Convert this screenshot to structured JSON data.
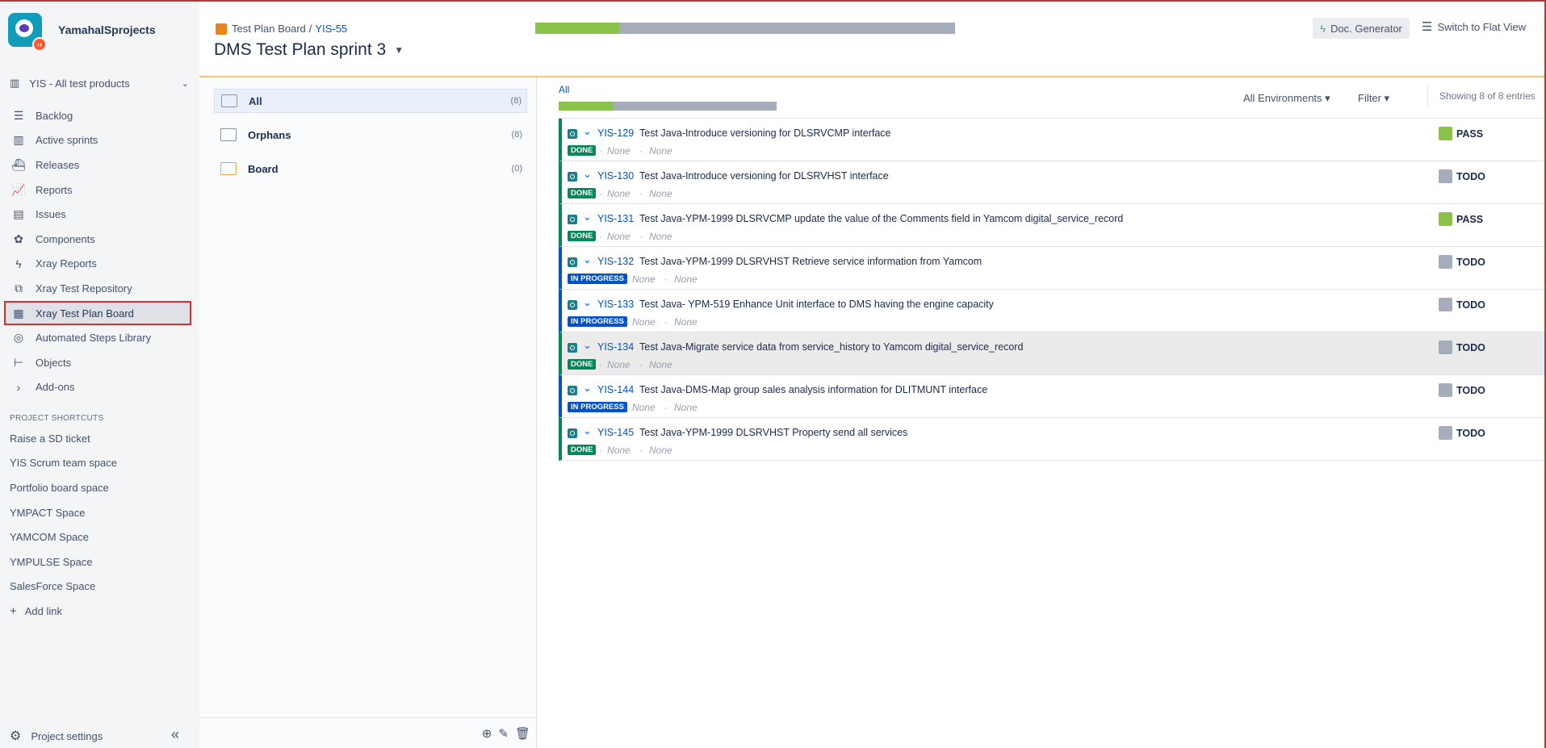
{
  "sidebar": {
    "project_name": "YamahalSprojects",
    "project_select": "YIS - All test products",
    "nav": [
      {
        "label": "Backlog",
        "icon": "backlog-icon",
        "glyph": "☰"
      },
      {
        "label": "Active sprints",
        "icon": "board-icon",
        "glyph": "▥"
      },
      {
        "label": "Releases",
        "icon": "ship-icon",
        "glyph": "⛴"
      },
      {
        "label": "Reports",
        "icon": "chart-icon",
        "glyph": "📈"
      },
      {
        "label": "Issues",
        "icon": "issues-icon",
        "glyph": "▤"
      },
      {
        "label": "Components",
        "icon": "puzzle-icon",
        "glyph": "✿"
      },
      {
        "label": "Xray Reports",
        "icon": "bolt-icon",
        "glyph": "ϟ"
      },
      {
        "label": "Xray Test Repository",
        "icon": "repository-icon",
        "glyph": "⧉"
      },
      {
        "label": "Xray Test Plan Board",
        "icon": "testplan-icon",
        "glyph": "▦",
        "active": true
      },
      {
        "label": "Automated Steps Library",
        "icon": "library-icon",
        "glyph": "◎"
      },
      {
        "label": "Objects",
        "icon": "tree-icon",
        "glyph": "⊢"
      },
      {
        "label": "Add-ons",
        "icon": "chevron-right-icon",
        "glyph": "›"
      }
    ],
    "shortcuts_title": "PROJECT SHORTCUTS",
    "shortcuts": [
      "Raise a SD ticket",
      "YIS Scrum team space",
      "Portfolio board space",
      "YMPACT Space",
      "YAMCOM Space",
      "YMPULSE Space",
      "SalesForce Space"
    ],
    "add_link": "Add link",
    "settings": "Project settings"
  },
  "header": {
    "crumb_board": "Test Plan Board",
    "crumb_sep": "/",
    "crumb_key": "YIS-55",
    "title": "DMS Test Plan sprint 3",
    "progress_pass_fraction": 0.2,
    "doc_generator": "Doc. Generator",
    "flat_view": "Switch to Flat View"
  },
  "folders": [
    {
      "label": "All",
      "count": "(8)",
      "selected": true
    },
    {
      "label": "Orphans",
      "count": "(8)"
    },
    {
      "label": "Board",
      "count": "(0)"
    }
  ],
  "main": {
    "all_label": "All",
    "progress_pass_fraction": 0.25,
    "environments": "All Environments ▾",
    "filter": "Filter ▾",
    "showing": "Showing 8 of 8 entries"
  },
  "rows": [
    {
      "key": "YIS-129",
      "summary": "Test Java-Introduce versioning for DLSRVCMP interface",
      "status": "DONE",
      "meta1": "None",
      "meta2": "None",
      "result": "PASS"
    },
    {
      "key": "YIS-130",
      "summary": "Test Java-Introduce versioning for DLSRVHST interface",
      "status": "DONE",
      "meta1": "None",
      "meta2": "None",
      "result": "TODO"
    },
    {
      "key": "YIS-131",
      "summary": "Test Java-YPM-1999 DLSRVCMP update the value of the Comments field in Yamcom digital_service_record",
      "status": "DONE",
      "meta1": "None",
      "meta2": "None",
      "result": "PASS"
    },
    {
      "key": "YIS-132",
      "summary": "Test Java-YPM-1999 DLSRVHST Retrieve service information from Yamcom",
      "status": "IN PROGRESS",
      "meta1": "None",
      "meta2": "None",
      "result": "TODO"
    },
    {
      "key": "YIS-133",
      "summary": "Test Java- YPM-519 Enhance Unit interface to DMS having the engine capacity",
      "status": "IN PROGRESS",
      "meta1": "None",
      "meta2": "None",
      "result": "TODO"
    },
    {
      "key": "YIS-134",
      "summary": "Test Java-Migrate service data from service_history to Yamcom digital_service_record",
      "status": "DONE",
      "meta1": "None",
      "meta2": "None",
      "result": "TODO"
    },
    {
      "key": "YIS-144",
      "summary": "Test Java-DMS-Map group sales analysis information for DLITMUNT interface",
      "status": "IN PROGRESS",
      "meta1": "None",
      "meta2": "None",
      "result": "TODO"
    },
    {
      "key": "YIS-145",
      "summary": "Test Java-YPM-1999 DLSRVHST Property send all services",
      "status": "DONE",
      "meta1": "None",
      "meta2": "None",
      "result": "TODO"
    }
  ],
  "colors": {
    "done": "#00875a",
    "in_progress": "#0052cc",
    "pass": "#8bc34a",
    "todo": "#a5adba",
    "accent_border": "#f0c674",
    "active_outline": "#d32f2f"
  }
}
